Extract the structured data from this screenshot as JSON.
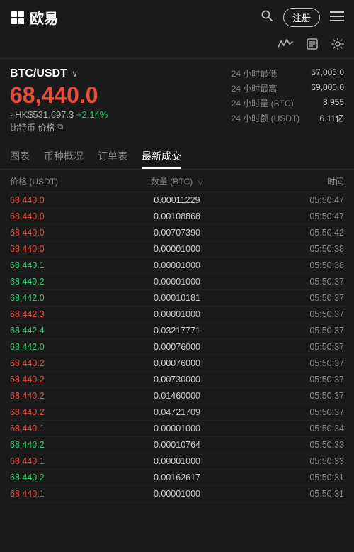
{
  "header": {
    "logo_text": "欧易",
    "register_label": "注册",
    "search_icon": "🔍",
    "menu_icon": "☰"
  },
  "subheader": {
    "chart_icon": "〜",
    "book_icon": "📋",
    "gear_icon": "⚙"
  },
  "pair": {
    "name": "BTC/USDT",
    "arrow": "∨",
    "main_price": "68,440.0",
    "hk_price": "≈HK$531,697.3",
    "change": "+2.14%",
    "label": "比特币 价格",
    "ext_link": "⧉",
    "stat1_label": "24 小时最低",
    "stat1_value": "67,005.0",
    "stat2_label": "24 小时最高",
    "stat2_value": "69,000.0",
    "stat3_label": "24 小时量 (BTC)",
    "stat3_value": "8,955",
    "stat4_label": "24 小时额 (USDT)",
    "stat4_value": "6.11亿"
  },
  "tabs": [
    {
      "label": "图表",
      "active": false
    },
    {
      "label": "币种概况",
      "active": false
    },
    {
      "label": "订单表",
      "active": false
    },
    {
      "label": "最新成交",
      "active": true
    }
  ],
  "table": {
    "col1": "价格 (USDT)",
    "col2": "数量 (BTC)",
    "col3": "时间",
    "filter_icon": "▽",
    "rows": [
      {
        "price": "68,440.0",
        "color": "red",
        "qty": "0.00011229",
        "time": "05:50:47"
      },
      {
        "price": "68,440.0",
        "color": "red",
        "qty": "0.00108868",
        "time": "05:50:47"
      },
      {
        "price": "68,440.0",
        "color": "red",
        "qty": "0.00707390",
        "time": "05:50:42"
      },
      {
        "price": "68,440.0",
        "color": "red",
        "qty": "0.00001000",
        "time": "05:50:38"
      },
      {
        "price": "68,440.1",
        "color": "green",
        "qty": "0.00001000",
        "time": "05:50:38"
      },
      {
        "price": "68,440.2",
        "color": "green",
        "qty": "0.00001000",
        "time": "05:50:37"
      },
      {
        "price": "68,442.0",
        "color": "green",
        "qty": "0.00010181",
        "time": "05:50:37"
      },
      {
        "price": "68,442.3",
        "color": "red",
        "qty": "0.00001000",
        "time": "05:50:37"
      },
      {
        "price": "68,442.4",
        "color": "green",
        "qty": "0.03217771",
        "time": "05:50:37"
      },
      {
        "price": "68,442.0",
        "color": "green",
        "qty": "0.00076000",
        "time": "05:50:37"
      },
      {
        "price": "68,440.2",
        "color": "red",
        "qty": "0.00076000",
        "time": "05:50:37"
      },
      {
        "price": "68,440.2",
        "color": "red",
        "qty": "0.00730000",
        "time": "05:50:37"
      },
      {
        "price": "68,440.2",
        "color": "red",
        "qty": "0.01460000",
        "time": "05:50:37"
      },
      {
        "price": "68,440.2",
        "color": "red",
        "qty": "0.04721709",
        "time": "05:50:37"
      },
      {
        "price": "68,440.1",
        "color": "red",
        "qty": "0.00001000",
        "time": "05:50:34"
      },
      {
        "price": "68,440.2",
        "color": "green",
        "qty": "0.00010764",
        "time": "05:50:33"
      },
      {
        "price": "68,440.1",
        "color": "red",
        "qty": "0.00001000",
        "time": "05:50:33"
      },
      {
        "price": "68,440.2",
        "color": "green",
        "qty": "0.00162617",
        "time": "05:50:31"
      },
      {
        "price": "68,440.1",
        "color": "red",
        "qty": "0.00001000",
        "time": "05:50:31"
      }
    ]
  }
}
